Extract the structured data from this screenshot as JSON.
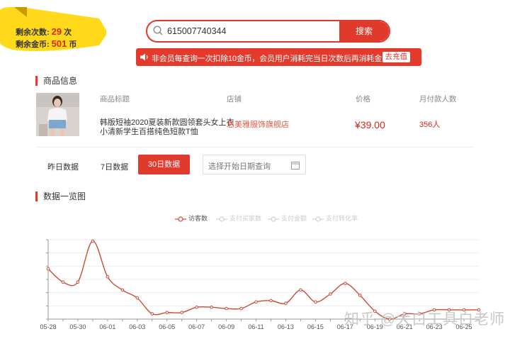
{
  "quota": {
    "times_label": "剩余次数:",
    "times_value": "29",
    "times_unit": "次",
    "coins_label": "剩余金币:",
    "coins_value": "501",
    "coins_unit": "币"
  },
  "search": {
    "value": "615007740344",
    "button": "搜索"
  },
  "notice": {
    "text": "非会员每查询一次扣除10金币，会员用户消耗完当日次数后再消耗金币。",
    "recharge": "去充值"
  },
  "product_section": {
    "title": "商品信息",
    "headers": {
      "title": "商品标题",
      "shop": "店铺",
      "price": "价格",
      "monthly": "月付款人数"
    },
    "item": {
      "title_line1": "韩版短袖2020夏装新款圆领套头女上衣",
      "title_line2": "小清新学生百搭纯色短款T恤",
      "shop": "恩美雅服饰旗舰店",
      "price": "¥39.00",
      "monthly": "356人"
    }
  },
  "tabs": {
    "yesterday": "昨日数据",
    "seven": "7日数据",
    "thirty": "30日数据",
    "date_placeholder": "选择开始日期查询"
  },
  "chart_section": {
    "title": "数据一览图"
  },
  "colors": {
    "accent": "#e03a2d",
    "line": "#cc4a35"
  },
  "chart_data": {
    "type": "line",
    "x": [
      "05-28",
      "05-29",
      "05-30",
      "05-31",
      "06-01",
      "06-02",
      "06-03",
      "06-04",
      "06-05",
      "06-06",
      "06-07",
      "06-08",
      "06-09",
      "06-10",
      "06-11",
      "06-12",
      "06-13",
      "06-14",
      "06-15",
      "06-16",
      "06-17",
      "06-18",
      "06-19",
      "06-20",
      "06-21",
      "06-22",
      "06-23",
      "06-24",
      "06-25",
      "06-26"
    ],
    "x_tick_labels": [
      "05-28",
      "05-30",
      "06-01",
      "06-03",
      "06-05",
      "06-07",
      "06-09",
      "06-11",
      "06-13",
      "06-15",
      "06-17",
      "06-19",
      "06-21",
      "06-23",
      "06-25"
    ],
    "series": [
      {
        "name": "访客数",
        "active": true,
        "values": [
          38,
          28,
          28,
          59,
          32,
          22,
          16,
          4,
          5,
          5,
          9,
          9,
          8,
          8,
          13,
          14,
          12,
          22,
          13,
          19,
          27,
          18,
          6,
          0,
          4,
          4,
          7,
          7,
          7,
          7
        ]
      },
      {
        "name": "支付买家数",
        "active": false,
        "values": []
      },
      {
        "name": "支付金额",
        "active": false,
        "values": []
      },
      {
        "name": "支付转化率",
        "active": false,
        "values": []
      }
    ],
    "ylim": [
      0,
      60
    ],
    "grid": true,
    "legend": "top-center"
  },
  "watermark": "知乎 @大白工具白老师"
}
